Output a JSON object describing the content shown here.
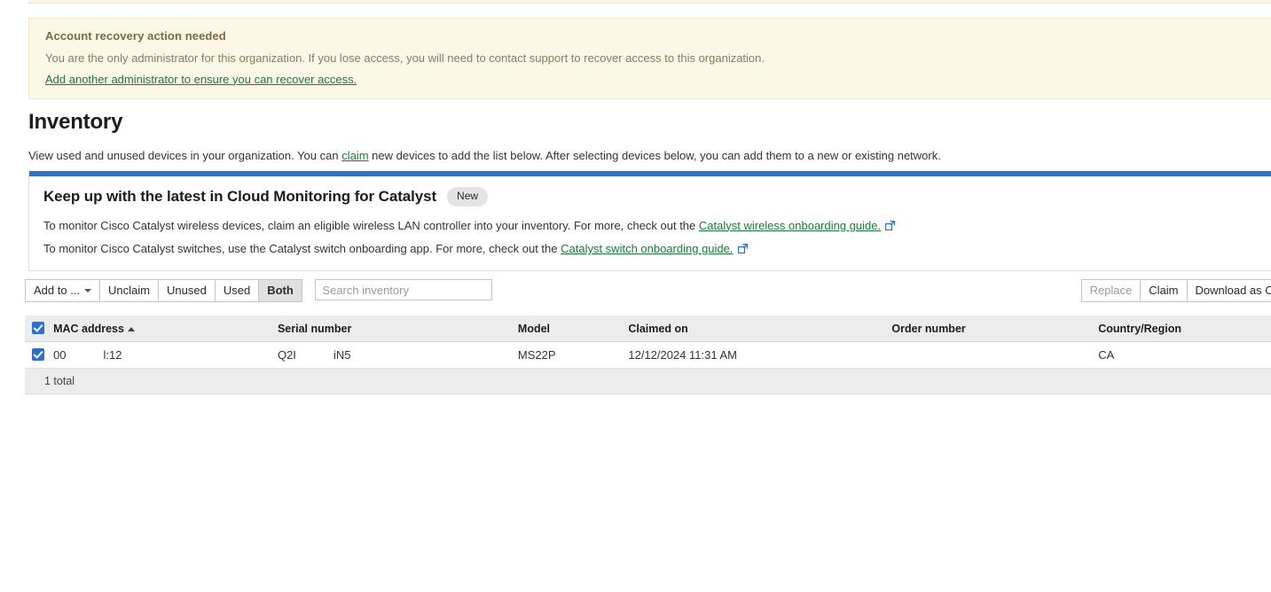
{
  "warning_banner": {
    "title": "Account recovery action needed",
    "body": "You are the only administrator for this organization. If you lose access, you will need to contact support to recover access to this organization.",
    "link": "Add another administrator to ensure you can recover access."
  },
  "page": {
    "title": "Inventory",
    "description_before": "View used and unused devices in your organization. You can ",
    "description_link": "claim",
    "description_after": " new devices to add the list below. After selecting devices below, you can add them to a new or existing network."
  },
  "info_banner": {
    "accent_color": "#3072c4",
    "title": "Keep up with the latest in Cloud Monitoring for Catalyst",
    "badge": "New",
    "line1_before": "To monitor Cisco Catalyst wireless devices, claim an eligible wireless LAN controller into your inventory. For more, check out the ",
    "line1_link": "Catalyst wireless onboarding guide.",
    "line2_before": "To monitor Cisco Catalyst switches, use the Catalyst switch onboarding app. For more, check out the ",
    "line2_link": "Catalyst switch onboarding guide.",
    "external_icon": "external-link-icon"
  },
  "toolbar": {
    "add_to_label": "Add to ...",
    "unclaim_label": "Unclaim",
    "filters": [
      "Unused",
      "Used",
      "Both"
    ],
    "active_filter": "Both",
    "search_placeholder": "Search inventory",
    "search_value": "",
    "replace_label": "Replace",
    "claim_label": "Claim",
    "download_label": "Download as CSV"
  },
  "table": {
    "headers": [
      "MAC address",
      "Serial number",
      "Model",
      "Claimed on",
      "Order number",
      "Country/Region"
    ],
    "sorted_column": "MAC address",
    "sort_direction": "ascending",
    "header_select_all_checked": true,
    "rows": [
      {
        "checked": true,
        "mac_prefix": "00",
        "mac_suffix": "l:12",
        "serial_prefix": "Q2I",
        "serial_suffix": "iN5",
        "model": "MS22P",
        "claimed_on": "12/12/2024 11:31 AM",
        "order_number": "",
        "country_region": "CA"
      }
    ],
    "footer": "1 total"
  },
  "colors": {
    "link_green": "#1a7a3c",
    "accent_blue": "#3072c4",
    "checkbox_blue": "#2a6fd6",
    "warn_bg": "#fcf8e8"
  }
}
